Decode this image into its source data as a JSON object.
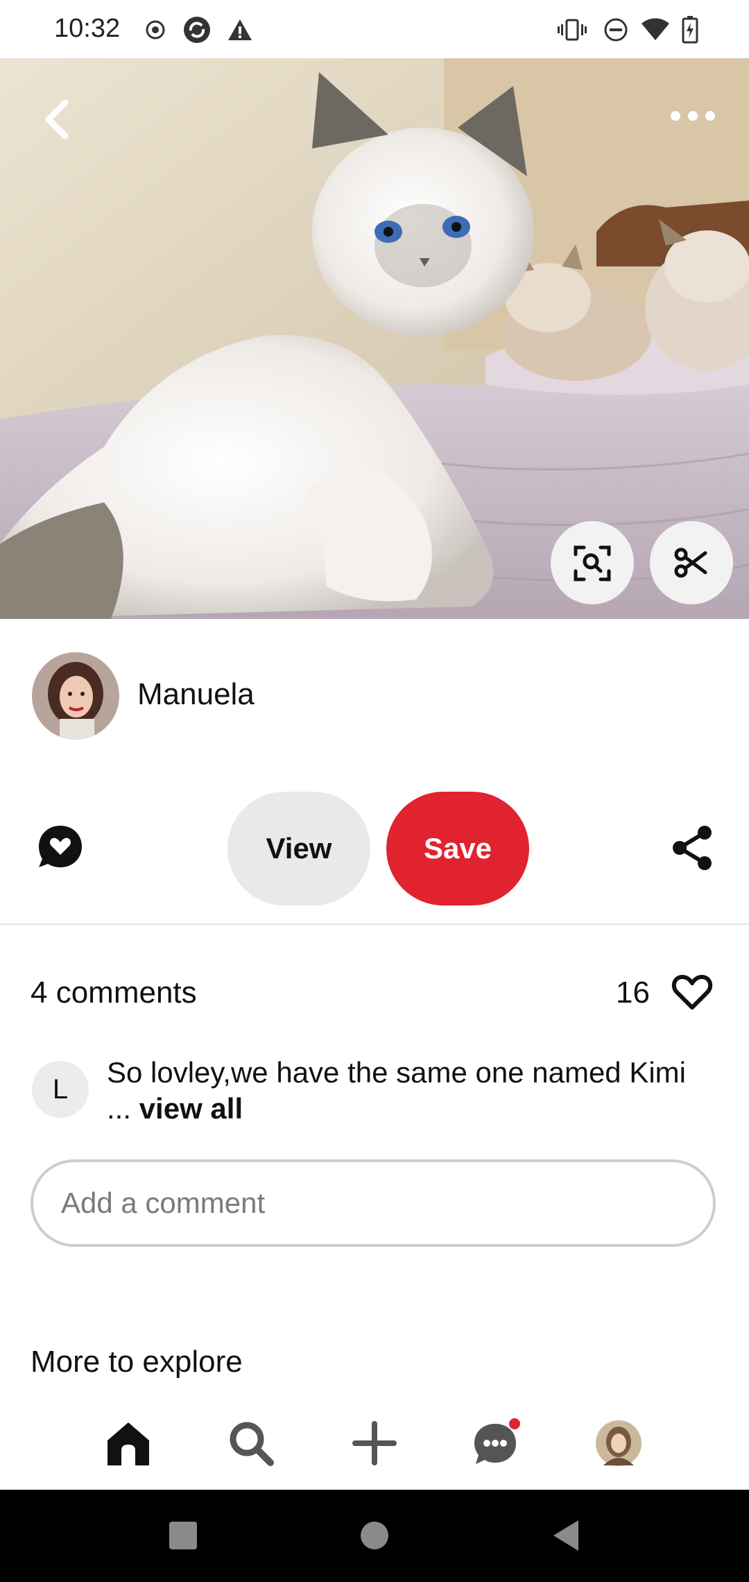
{
  "status_bar": {
    "time": "10:32",
    "icons": [
      "record-icon",
      "sync-icon",
      "alert-icon",
      "vibrate-icon",
      "dnd-icon",
      "wifi-icon",
      "battery-icon"
    ]
  },
  "pin": {
    "image_subject": "fluffy white kitten on bed",
    "author": {
      "name": "Manuela"
    },
    "actions": {
      "view_label": "View",
      "save_label": "Save"
    },
    "comments": {
      "count_label": "4 comments",
      "likes": "16",
      "preview": {
        "initial": "L",
        "text": "So lovley,we have the same one named Kimi ...",
        "view_all": "view all"
      },
      "input_placeholder": "Add a comment"
    },
    "more_title": "More to explore"
  },
  "bottom_nav": {
    "items": [
      "home-icon",
      "search-icon",
      "create-icon",
      "messages-icon",
      "profile-avatar"
    ]
  },
  "colors": {
    "save_red": "#e0232e",
    "notification_dot": "#e0232e"
  }
}
